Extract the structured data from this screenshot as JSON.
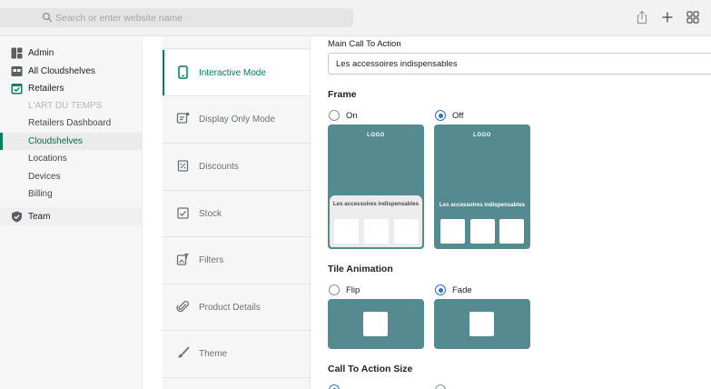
{
  "browser": {
    "search_placeholder": "Search or enter website name",
    "icons": [
      "search-icon",
      "share-icon",
      "new-tab-icon",
      "tab-overview-icon"
    ]
  },
  "sidebar": {
    "items": [
      {
        "label": "Admin",
        "icon": "admin-icon"
      },
      {
        "label": "All Cloudshelves",
        "icon": "cloudshelves-icon"
      },
      {
        "label": "Retailers",
        "icon": "retailers-icon"
      },
      {
        "label": "L'ART DU TEMPS"
      },
      {
        "label": "Retailers Dashboard"
      },
      {
        "label": "Cloudshelves"
      },
      {
        "label": "Locations"
      },
      {
        "label": "Devices"
      },
      {
        "label": "Billing"
      },
      {
        "label": "Team",
        "icon": "shield-icon"
      }
    ],
    "active": "Cloudshelves"
  },
  "tabs": [
    {
      "label": "Interactive Mode",
      "icon": "tablet-icon"
    },
    {
      "label": "Display Only Mode",
      "icon": "display-icon"
    },
    {
      "label": "Discounts",
      "icon": "discount-icon"
    },
    {
      "label": "Stock",
      "icon": "stock-icon"
    },
    {
      "label": "Filters",
      "icon": "filter-icon"
    },
    {
      "label": "Product Details",
      "icon": "paperclip-icon"
    },
    {
      "label": "Theme",
      "icon": "brush-icon"
    }
  ],
  "main": {
    "cta_label": "Main Call To Action",
    "cta_value": "Les accessoires indispensables",
    "frame": {
      "title": "Frame",
      "options": [
        {
          "label": "On",
          "selected": false
        },
        {
          "label": "Off",
          "selected": true
        }
      ],
      "logo_text": "LOGO",
      "preview_text": "Les accessoires indispensables"
    },
    "tile_animation": {
      "title": "Tile Animation",
      "options": [
        {
          "label": "Flip",
          "selected": false
        },
        {
          "label": "Fade",
          "selected": true
        }
      ]
    },
    "cta_size": {
      "title": "Call To Action Size"
    }
  },
  "colors": {
    "accent": "#008060",
    "preview_teal": "#558a91",
    "radio_selected": "#2c6ecb"
  }
}
